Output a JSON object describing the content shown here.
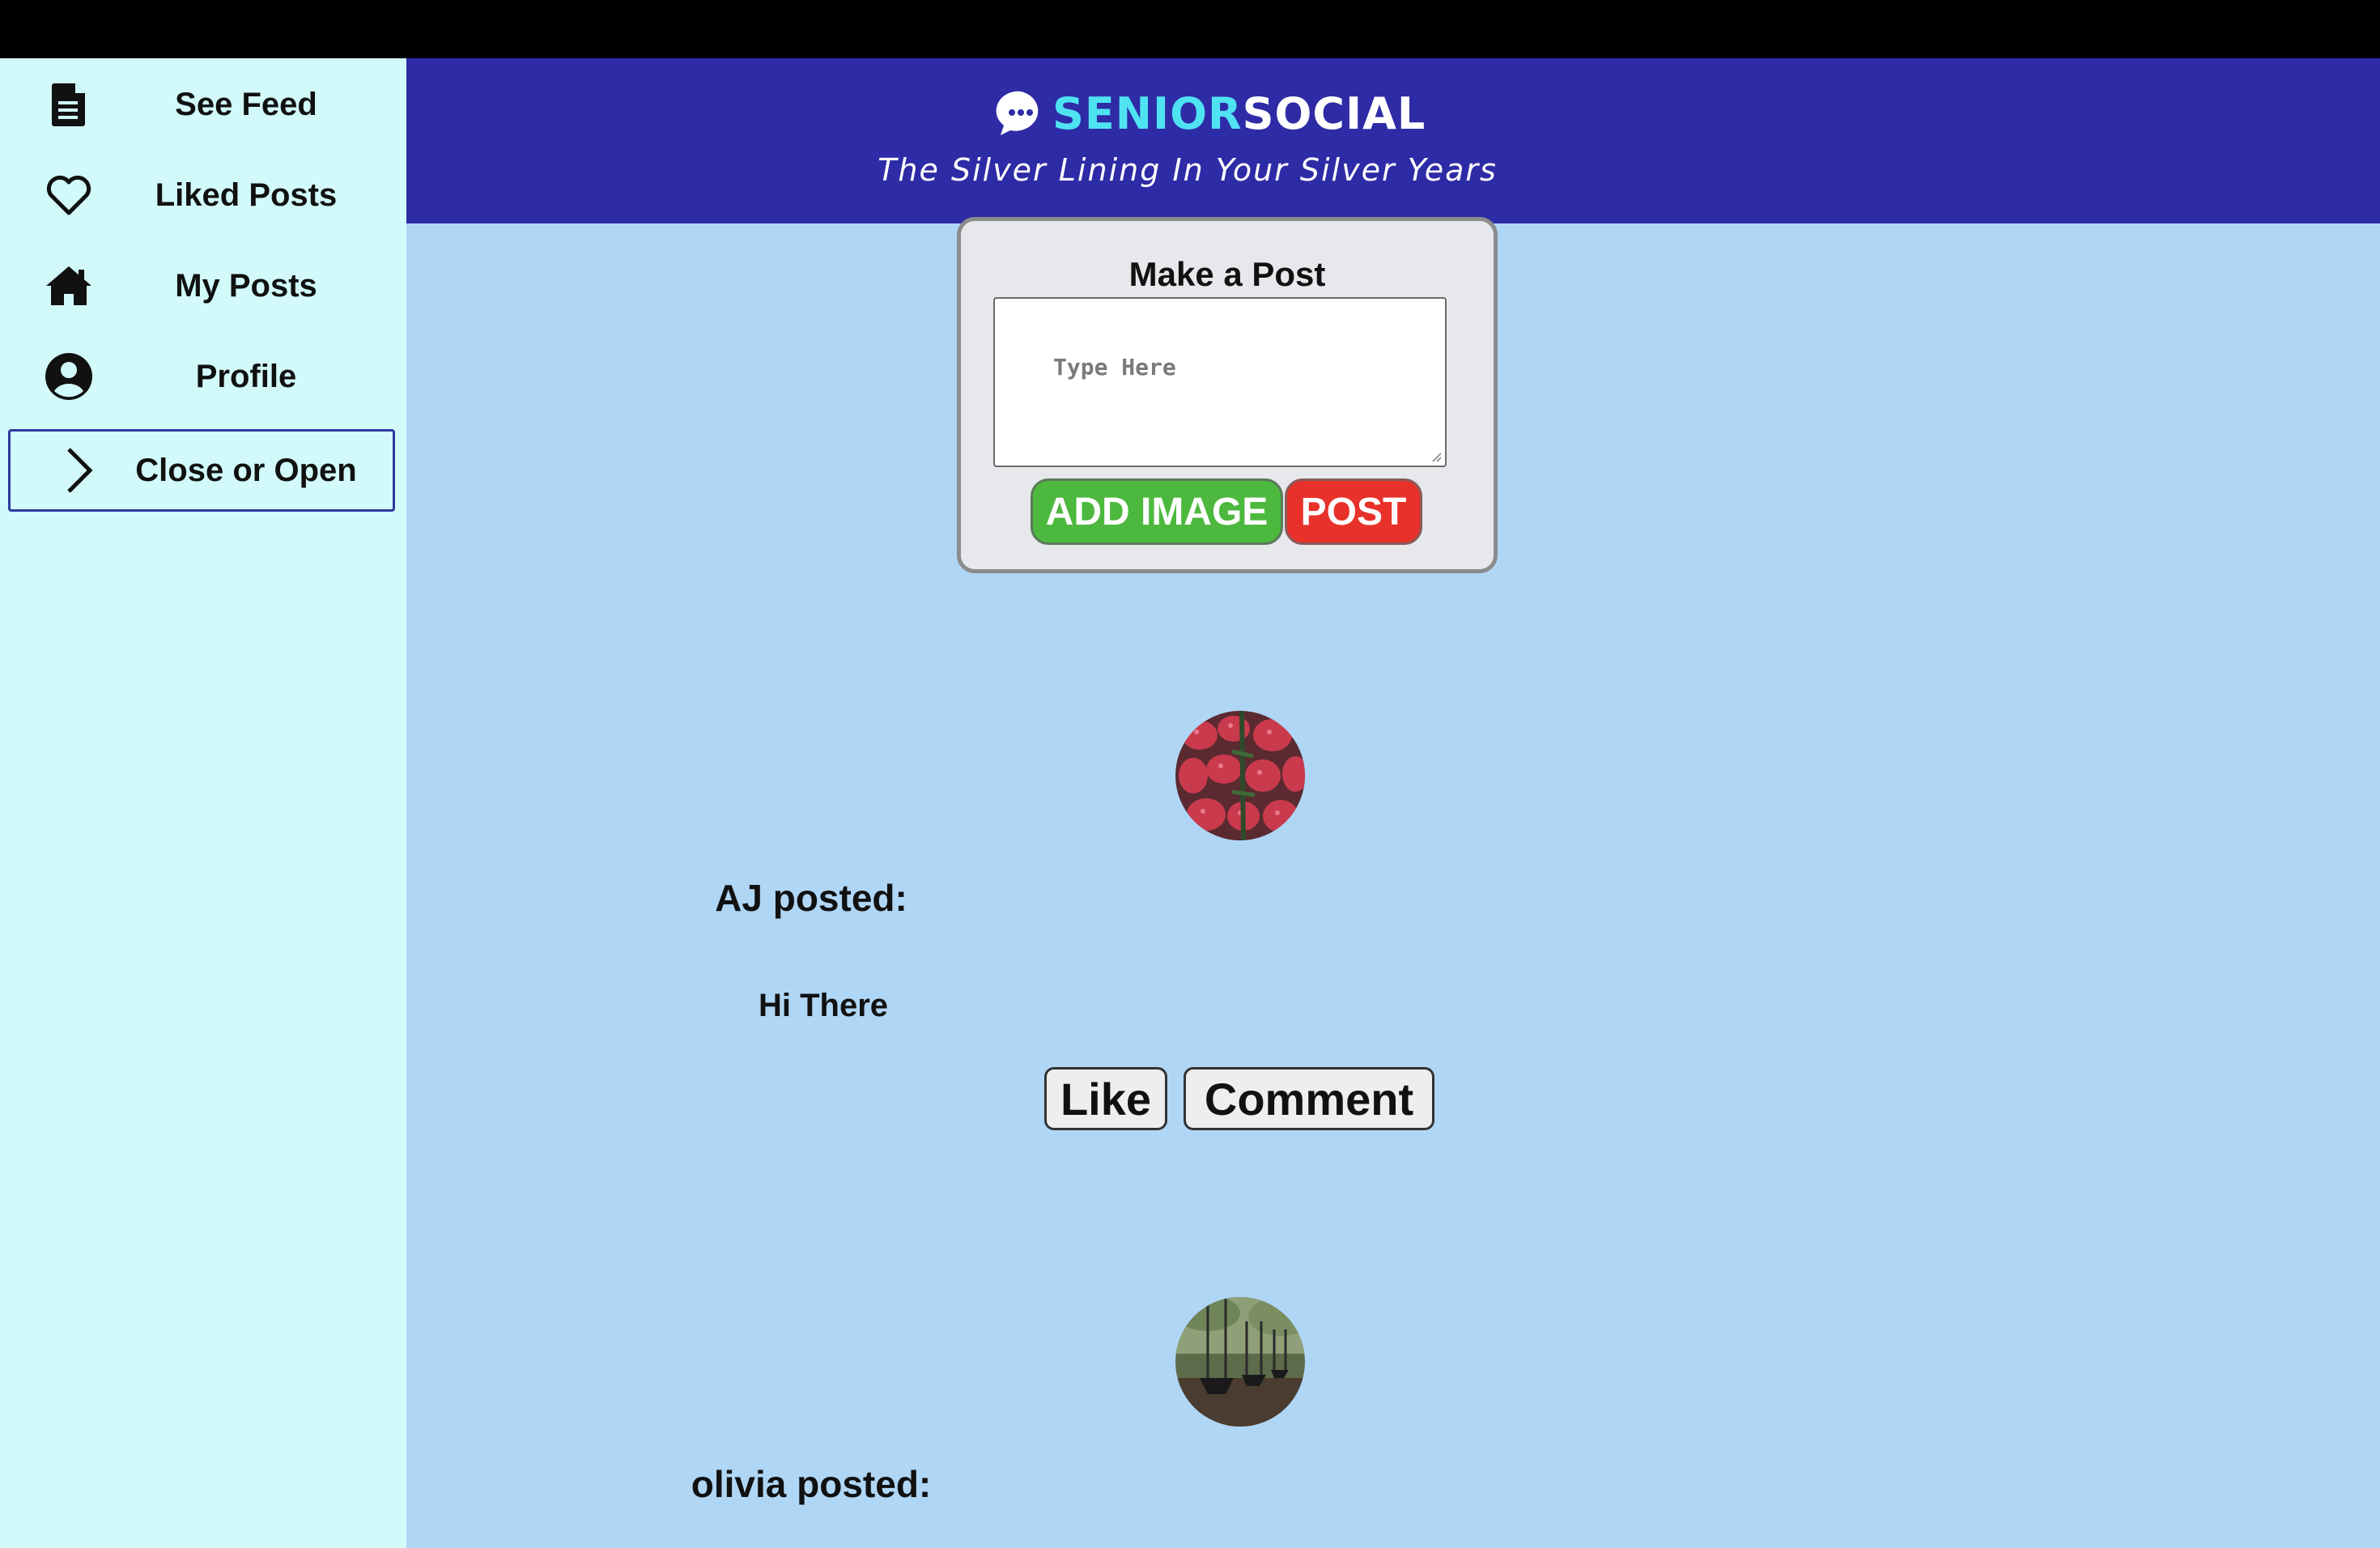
{
  "sidebar": {
    "items": [
      {
        "label": "See Feed",
        "icon": "document-icon"
      },
      {
        "label": "Liked Posts",
        "icon": "heart-icon"
      },
      {
        "label": "My Posts",
        "icon": "home-icon"
      },
      {
        "label": "Profile",
        "icon": "user-circle-icon"
      },
      {
        "label": "Close or Open",
        "icon": "chevron-right-icon"
      }
    ]
  },
  "header": {
    "brand_part1": "SENIOR",
    "brand_part2": "SOCIAL",
    "tagline": "The Silver Lining In Your Silver Years"
  },
  "composer": {
    "title": "Make a Post",
    "placeholder": "Type Here",
    "add_image_label": "ADD IMAGE",
    "post_label": "POST"
  },
  "feed": [
    {
      "author_line": "AJ posted:",
      "content": "Hi There",
      "like_label": "Like",
      "comment_label": "Comment",
      "avatar": "strawberries"
    },
    {
      "author_line": "olivia posted:",
      "avatar": "swings"
    }
  ],
  "colors": {
    "top_bar": "#000000",
    "sidebar_bg": "#d2fafa",
    "main_bg": "#b0d6f5",
    "header_bg": "#2e2ba6",
    "brand_accent": "#4fe3f2",
    "add_image_bg": "#4db83e",
    "post_bg": "#e8312a"
  }
}
